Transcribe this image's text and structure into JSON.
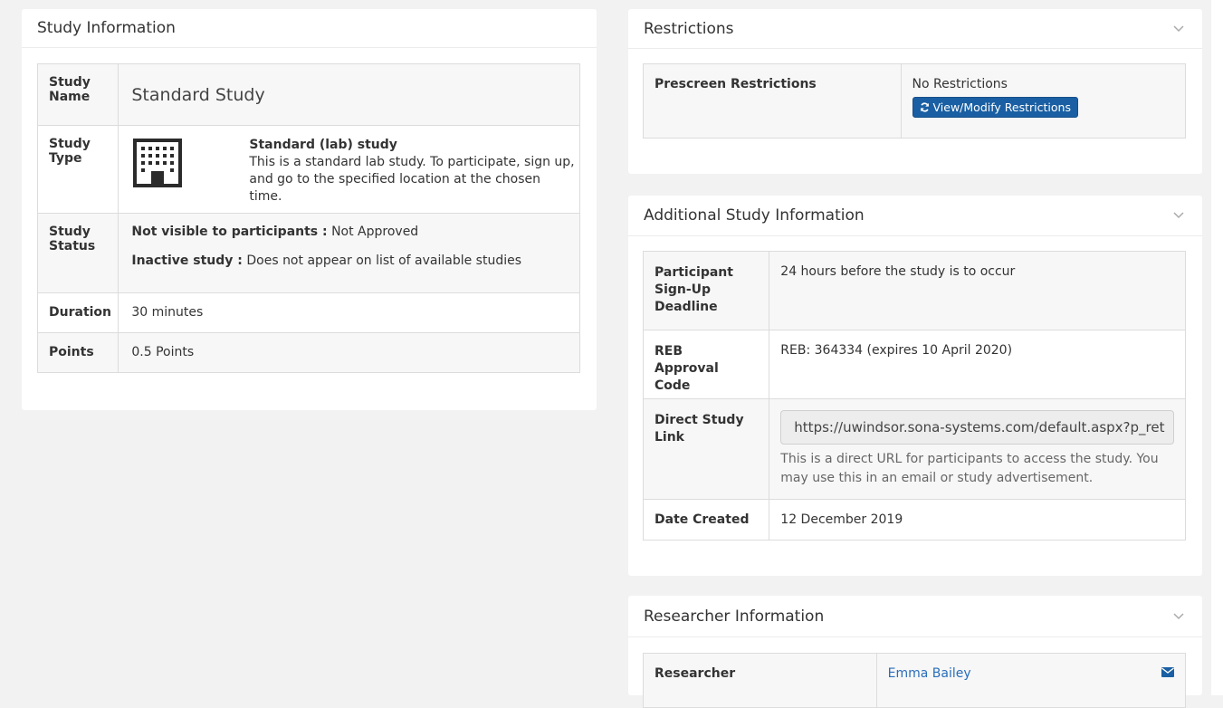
{
  "study_info": {
    "title": "Study Information",
    "rows": {
      "name_label": "Study Name",
      "name_value": "Standard Study",
      "type_label": "Study Type",
      "type_title": "Standard (lab) study",
      "type_desc": "This is a standard lab study. To participate, sign up, and go to the specified location at the chosen time.",
      "status_label": "Study Status",
      "status_line1_label": "Not visible to participants :",
      "status_line1_value": "Not Approved",
      "status_line2_label": "Inactive study :",
      "status_line2_value": "Does not appear on list of available studies",
      "duration_label": "Duration",
      "duration_value": "30 minutes",
      "points_label": "Points",
      "points_value": "0.5 Points"
    }
  },
  "restrictions": {
    "title": "Restrictions",
    "prescreen_label": "Prescreen Restrictions",
    "prescreen_value": "No Restrictions",
    "modify_button": "View/Modify Restrictions"
  },
  "additional": {
    "title": "Additional Study Information",
    "deadline_label": "Participant Sign-Up Deadline",
    "deadline_value": "24 hours before the study is to occur",
    "reb_label": "REB Approval Code",
    "reb_value": "REB: 364334 (expires 10 April 2020)",
    "link_label": "Direct Study Link",
    "link_value": "https://uwindsor.sona-systems.com/default.aspx?p_ret",
    "link_help": "This is a direct URL for participants to access the study. You may use this in an email or study advertisement.",
    "created_label": "Date Created",
    "created_value": "12 December 2019"
  },
  "researcher": {
    "title": "Researcher Information",
    "researcher_label": "Researcher",
    "researcher_name": "Emma Bailey"
  },
  "icons": {
    "building": "building-icon",
    "chevron": "chevron-down-icon",
    "refresh": "refresh-icon",
    "envelope": "envelope-icon"
  },
  "colors": {
    "accent": "#1a5fa3",
    "link": "#2a6ebb"
  }
}
